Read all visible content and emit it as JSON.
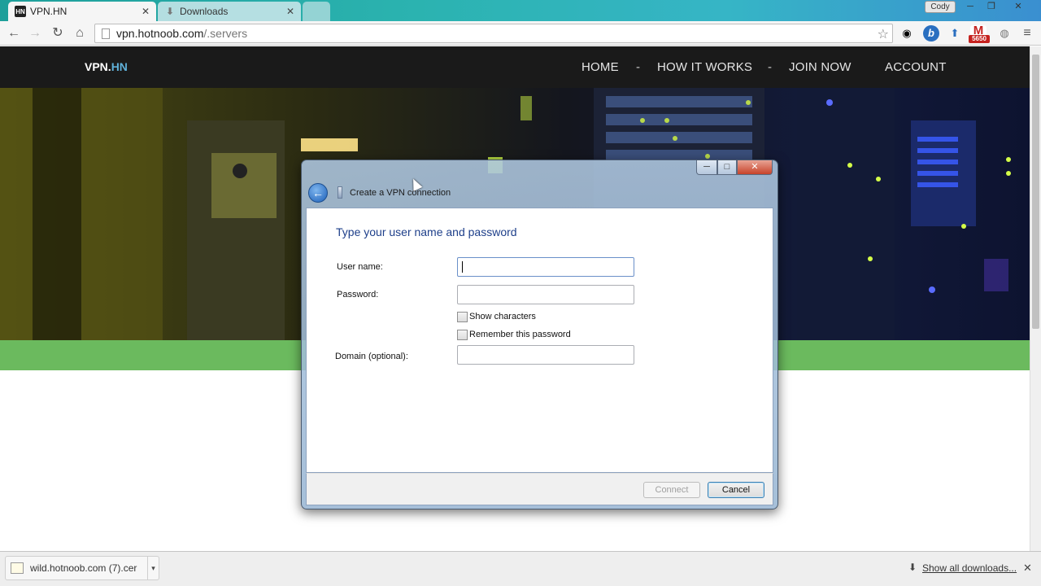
{
  "browser": {
    "tabs": [
      {
        "title": "VPN.HN",
        "favicon": "HN"
      },
      {
        "title": "Downloads"
      }
    ],
    "profile": "Cody",
    "url_host": "vpn.hotnoob.com",
    "url_path": "/.servers",
    "ext_badge": "5650"
  },
  "site": {
    "logo_main": "VPN.",
    "logo_accent": "HN",
    "nav": [
      "HOME",
      "HOW IT WORKS",
      "JOIN NOW",
      "ACCOUNT"
    ],
    "separator": "-"
  },
  "dialog": {
    "title": "Create a VPN connection",
    "heading": "Type your user name and password",
    "username_label": "User name:",
    "username_value": "",
    "password_label": "Password:",
    "password_value": "",
    "show_characters_label": "Show characters",
    "show_characters_checked": false,
    "remember_label": "Remember this password",
    "remember_checked": false,
    "domain_label": "Domain (optional):",
    "domain_value": "",
    "connect_label": "Connect",
    "cancel_label": "Cancel"
  },
  "downloads": {
    "file": "wild.hotnoob.com (7).cer",
    "show_all": "Show all downloads..."
  },
  "colors": {
    "nav_bg": "#1a1a1a",
    "green_bar": "#6bba5e",
    "logo_accent": "#5fb0d8",
    "dialog_heading": "#1e3f8a"
  }
}
